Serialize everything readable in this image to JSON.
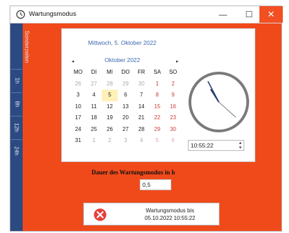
{
  "window": {
    "title": "Wartungsmodus",
    "min_glyph": "—",
    "max_glyph": "☐",
    "close_glyph": "✕",
    "app_icon": "clock-icon"
  },
  "sidebar": {
    "items": [
      {
        "label": "Sonderzeiten"
      },
      {
        "label": "1h"
      },
      {
        "label": "8h"
      },
      {
        "label": "12h"
      },
      {
        "label": "24h"
      }
    ]
  },
  "calendar": {
    "selected_date_text": "Mittwoch, 5. Oktober 2022",
    "month_label": "Oktober 2022",
    "prev_glyph": "◂",
    "next_glyph": "▸",
    "weekdays": [
      "MO",
      "DI",
      "MI",
      "DO",
      "FR",
      "SA",
      "SO"
    ],
    "weeks": [
      [
        "26",
        "27",
        "28",
        "29",
        "30",
        "1",
        "2"
      ],
      [
        "3",
        "4",
        "5",
        "6",
        "7",
        "8",
        "9"
      ],
      [
        "10",
        "11",
        "12",
        "13",
        "14",
        "15",
        "16"
      ],
      [
        "17",
        "18",
        "19",
        "20",
        "21",
        "22",
        "23"
      ],
      [
        "24",
        "25",
        "26",
        "27",
        "28",
        "29",
        "30"
      ],
      [
        "31",
        "1",
        "2",
        "3",
        "4",
        "5",
        "6"
      ]
    ],
    "today": "5"
  },
  "clock": {
    "time_value": "10:55:22",
    "hour": 10,
    "minute": 55,
    "second": 22,
    "spin_up": "▴",
    "spin_down": "▾"
  },
  "duration": {
    "label": "Dauer des Wartungsmodus in h",
    "value": "0,5"
  },
  "status": {
    "icon": "error-x-icon",
    "line1": "Wartungsmodus bis",
    "line2": "05.10.2022 10:55:22"
  },
  "colors": {
    "background": "#f04a1b",
    "sidebar": "#2c4a82",
    "accent_text": "#3a67b0",
    "weekend": "#d23b3b",
    "status_icon": "#e5413a"
  }
}
